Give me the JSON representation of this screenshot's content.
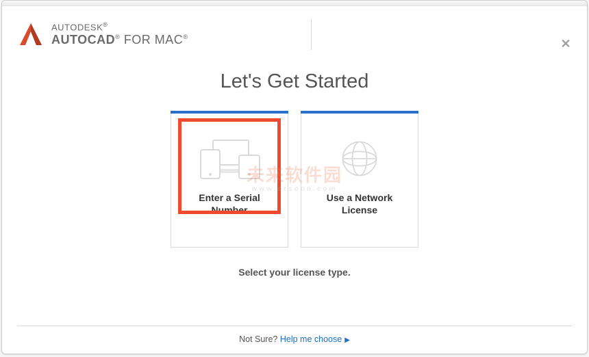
{
  "brand": {
    "line1": "AUTODESK",
    "line2_bold": "AUTOCAD",
    "line2_rest": " FOR MAC"
  },
  "heading": "Let's Get Started",
  "cards": {
    "serial": {
      "label_l1": "Enter a Serial",
      "label_l2": "Number"
    },
    "network": {
      "label_l1": "Use a Network",
      "label_l2": "License"
    }
  },
  "subtitle": "Select your license type.",
  "footer": {
    "prefix": "Not Sure? ",
    "link": "Help me choose"
  },
  "watermark": {
    "main": "未来软件园",
    "sub": "www.orsoon.com"
  }
}
